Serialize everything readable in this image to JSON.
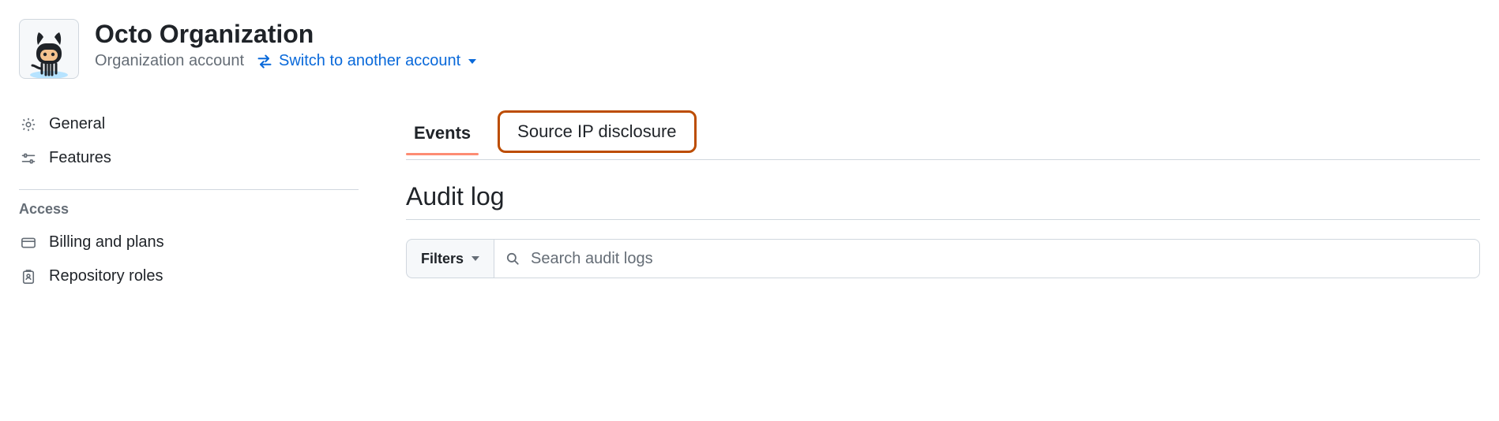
{
  "header": {
    "org_name": "Octo Organization",
    "account_label": "Organization account",
    "switch_label": "Switch to another account"
  },
  "sidebar": {
    "items_top": [
      {
        "label": "General",
        "icon": "gear"
      },
      {
        "label": "Features",
        "icon": "sliders"
      }
    ],
    "section_access": "Access",
    "items_access": [
      {
        "label": "Billing and plans",
        "icon": "credit-card"
      },
      {
        "label": "Repository roles",
        "icon": "id-badge"
      }
    ]
  },
  "main": {
    "tabs": [
      {
        "label": "Events",
        "active": true,
        "highlight": false
      },
      {
        "label": "Source IP disclosure",
        "active": false,
        "highlight": true
      }
    ],
    "heading": "Audit log",
    "filters_label": "Filters",
    "search_placeholder": "Search audit logs"
  }
}
